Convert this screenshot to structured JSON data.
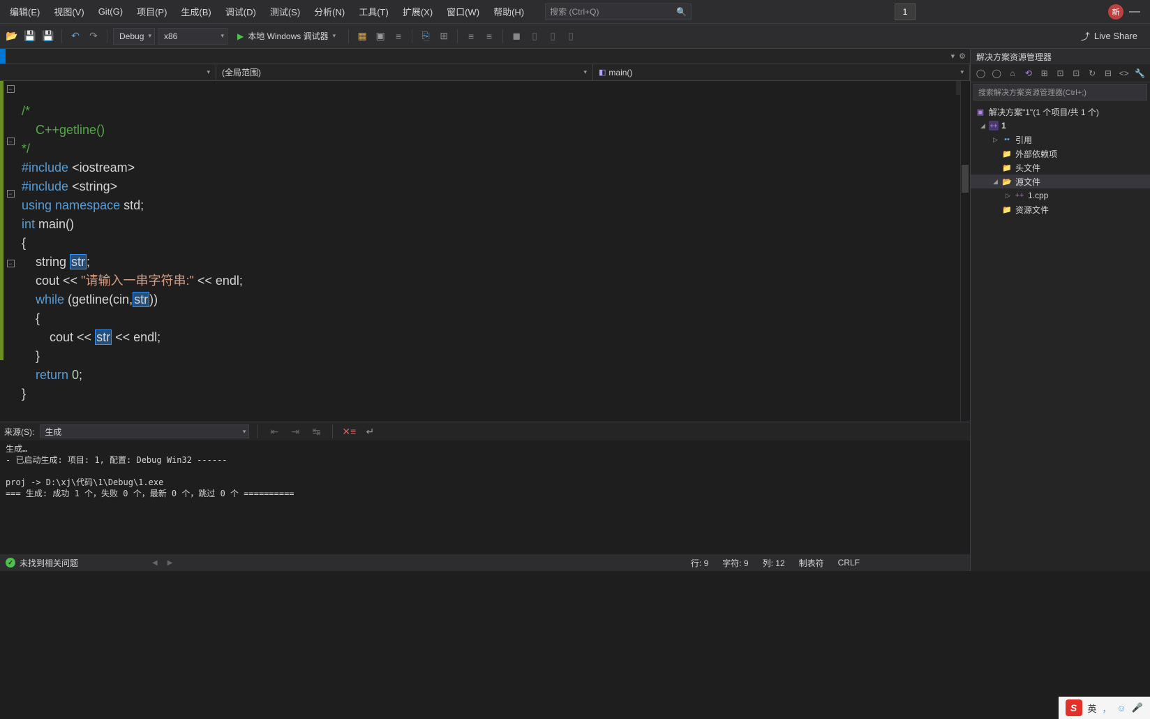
{
  "menus": [
    "编辑(E)",
    "视图(V)",
    "Git(G)",
    "项目(P)",
    "生成(B)",
    "调试(D)",
    "测试(S)",
    "分析(N)",
    "工具(T)",
    "扩展(X)",
    "窗口(W)",
    "帮助(H)"
  ],
  "search_placeholder": "搜索 (Ctrl+Q)",
  "project_indicator": "1",
  "news_badge": "新",
  "toolbar": {
    "config": "Debug",
    "platform": "x86",
    "debugger": "本地 Windows 调试器",
    "live_share": "Live Share"
  },
  "nav": {
    "scope": "(全局范围)",
    "func": "main()"
  },
  "code": {
    "line1": "/*",
    "line2": "    C++getline()",
    "line3": "*/",
    "line4a": "#include ",
    "line4b": "<iostream>",
    "line5a": "#include ",
    "line5b": "<string>",
    "line6a": "using ",
    "line6b": "namespace ",
    "line6c": "std;",
    "line7a": "int ",
    "line7b": "main",
    "line7c": "()",
    "line8": "{",
    "line9a": "    string ",
    "line9var": "str",
    "line9b": ";",
    "line10a": "    cout << ",
    "line10s": "\"请输入一串字符串:\"",
    "line10b": " << endl;",
    "line11a": "    while ",
    "line11b": "(getline(cin,",
    "line11var": "str",
    "line11c": "))",
    "line12": "    {",
    "line13a": "        cout << ",
    "line13var": "str",
    "line13b": " << endl;",
    "line14": "    }",
    "line15a": "    return ",
    "line15n": "0",
    "line15b": ";",
    "line16": "}"
  },
  "solution_explorer": {
    "title": "解决方案资源管理器",
    "search_placeholder": "搜索解决方案资源管理器(Ctrl+;)",
    "solution": "解决方案\"1\"(1 个项目/共 1 个)",
    "project": "1",
    "refs": "引用",
    "external": "外部依赖项",
    "headers": "头文件",
    "sources": "源文件",
    "file1": "1.cpp",
    "resources": "资源文件"
  },
  "output": {
    "source_label": "来源(S):",
    "source_value": "生成",
    "text": "生成…\n- 已启动生成: 项目: 1, 配置: Debug Win32 ------\n\nproj -> D:\\xj\\代码\\1\\Debug\\1.exe\n=== 生成: 成功 1 个，失败 0 个，最新 0 个，跳过 0 个 =========="
  },
  "status": {
    "issues": "未找到相关问题",
    "line": "行: 9",
    "char": "字符: 9",
    "col": "列: 12",
    "tabs": "制表符",
    "crlf": "CRLF"
  },
  "ime": {
    "lang": "英",
    "dot": "，"
  }
}
